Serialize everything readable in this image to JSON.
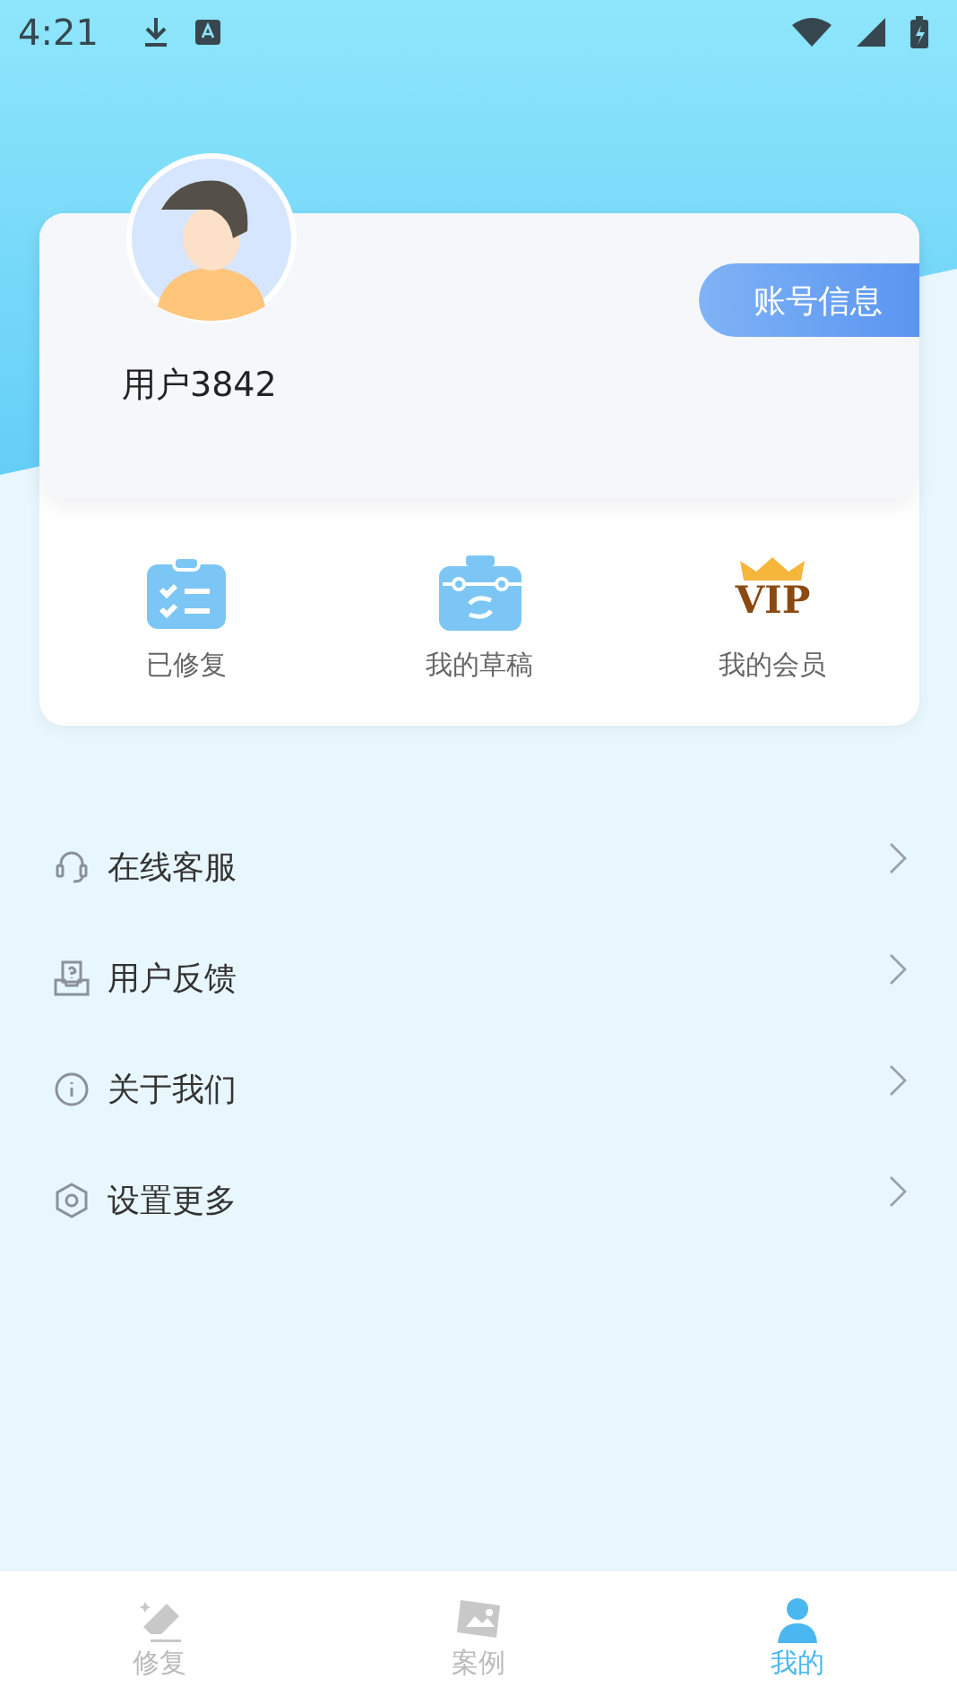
{
  "status_bar": {
    "time": "4:21"
  },
  "profile": {
    "username": "用户3842",
    "account_button": "账号信息"
  },
  "shortcuts": [
    {
      "label": "已修复",
      "kind": "checklist"
    },
    {
      "label": "我的草稿",
      "kind": "toolbox"
    },
    {
      "label": "我的会员",
      "kind": "vip",
      "badge": "VIP"
    }
  ],
  "menu": [
    {
      "label": "在线客服",
      "kind": "headset"
    },
    {
      "label": "用户反馈",
      "kind": "feedback"
    },
    {
      "label": "关于我们",
      "kind": "info"
    },
    {
      "label": "设置更多",
      "kind": "settings"
    }
  ],
  "tabs": [
    {
      "label": "修复",
      "kind": "eraser",
      "selected": false
    },
    {
      "label": "案例",
      "kind": "photos",
      "selected": false
    },
    {
      "label": "我的",
      "kind": "person",
      "selected": true
    }
  ]
}
